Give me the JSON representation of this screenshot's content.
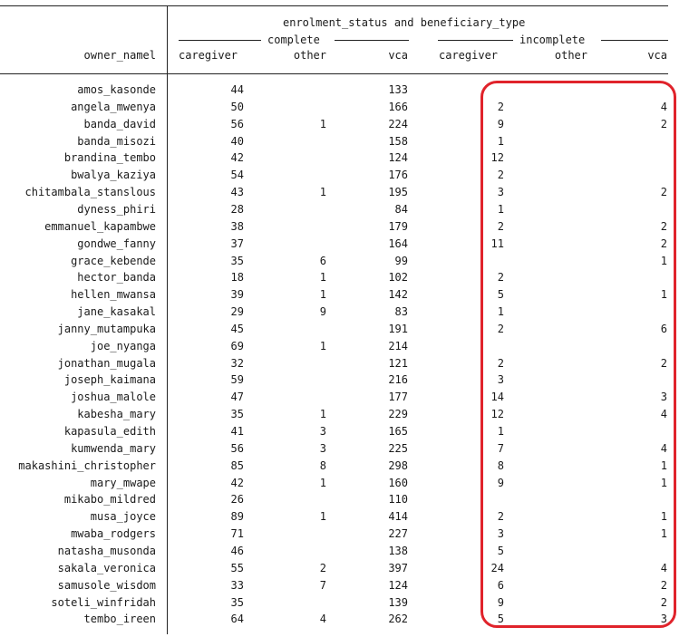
{
  "table": {
    "super_header": "enrolment_status and beneficiary_type",
    "group_complete": "complete",
    "group_incomplete": "incomplete",
    "row_header": "owner_namel",
    "columns": [
      "caregiver",
      "other",
      "vca",
      "caregiver",
      "other",
      "vca"
    ],
    "highlight_color": "#e0232b",
    "rows": [
      {
        "name": "amos_kasonde",
        "cc": "44",
        "co": "",
        "cv": "133",
        "ic": "",
        "io": "",
        "iv": ""
      },
      {
        "name": "angela_mwenya",
        "cc": "50",
        "co": "",
        "cv": "166",
        "ic": "2",
        "io": "",
        "iv": "4"
      },
      {
        "name": "banda_david",
        "cc": "56",
        "co": "1",
        "cv": "224",
        "ic": "9",
        "io": "",
        "iv": "2"
      },
      {
        "name": "banda_misozi",
        "cc": "40",
        "co": "",
        "cv": "158",
        "ic": "1",
        "io": "",
        "iv": ""
      },
      {
        "name": "brandina_tembo",
        "cc": "42",
        "co": "",
        "cv": "124",
        "ic": "12",
        "io": "",
        "iv": ""
      },
      {
        "name": "bwalya_kaziya",
        "cc": "54",
        "co": "",
        "cv": "176",
        "ic": "2",
        "io": "",
        "iv": ""
      },
      {
        "name": "chitambala_stanslous",
        "cc": "43",
        "co": "1",
        "cv": "195",
        "ic": "3",
        "io": "",
        "iv": "2"
      },
      {
        "name": "dyness_phiri",
        "cc": "28",
        "co": "",
        "cv": "84",
        "ic": "1",
        "io": "",
        "iv": ""
      },
      {
        "name": "emmanuel_kapambwe",
        "cc": "38",
        "co": "",
        "cv": "179",
        "ic": "2",
        "io": "",
        "iv": "2"
      },
      {
        "name": "gondwe_fanny",
        "cc": "37",
        "co": "",
        "cv": "164",
        "ic": "11",
        "io": "",
        "iv": "2"
      },
      {
        "name": "grace_kebende",
        "cc": "35",
        "co": "6",
        "cv": "99",
        "ic": "",
        "io": "",
        "iv": "1"
      },
      {
        "name": "hector_banda",
        "cc": "18",
        "co": "1",
        "cv": "102",
        "ic": "2",
        "io": "",
        "iv": ""
      },
      {
        "name": "hellen_mwansa",
        "cc": "39",
        "co": "1",
        "cv": "142",
        "ic": "5",
        "io": "",
        "iv": "1"
      },
      {
        "name": "jane_kasakal",
        "cc": "29",
        "co": "9",
        "cv": "83",
        "ic": "1",
        "io": "",
        "iv": ""
      },
      {
        "name": "janny_mutampuka",
        "cc": "45",
        "co": "",
        "cv": "191",
        "ic": "2",
        "io": "",
        "iv": "6"
      },
      {
        "name": "joe_nyanga",
        "cc": "69",
        "co": "1",
        "cv": "214",
        "ic": "",
        "io": "",
        "iv": ""
      },
      {
        "name": "jonathan_mugala",
        "cc": "32",
        "co": "",
        "cv": "121",
        "ic": "2",
        "io": "",
        "iv": "2"
      },
      {
        "name": "joseph_kaimana",
        "cc": "59",
        "co": "",
        "cv": "216",
        "ic": "3",
        "io": "",
        "iv": ""
      },
      {
        "name": "joshua_malole",
        "cc": "47",
        "co": "",
        "cv": "177",
        "ic": "14",
        "io": "",
        "iv": "3"
      },
      {
        "name": "kabesha_mary",
        "cc": "35",
        "co": "1",
        "cv": "229",
        "ic": "12",
        "io": "",
        "iv": "4"
      },
      {
        "name": "kapasula_edith",
        "cc": "41",
        "co": "3",
        "cv": "165",
        "ic": "1",
        "io": "",
        "iv": ""
      },
      {
        "name": "kumwenda_mary",
        "cc": "56",
        "co": "3",
        "cv": "225",
        "ic": "7",
        "io": "",
        "iv": "4"
      },
      {
        "name": "makashini_christopher",
        "cc": "85",
        "co": "8",
        "cv": "298",
        "ic": "8",
        "io": "",
        "iv": "1"
      },
      {
        "name": "mary_mwape",
        "cc": "42",
        "co": "1",
        "cv": "160",
        "ic": "9",
        "io": "",
        "iv": "1"
      },
      {
        "name": "mikabo_mildred",
        "cc": "26",
        "co": "",
        "cv": "110",
        "ic": "",
        "io": "",
        "iv": ""
      },
      {
        "name": "musa_joyce",
        "cc": "89",
        "co": "1",
        "cv": "414",
        "ic": "2",
        "io": "",
        "iv": "1"
      },
      {
        "name": "mwaba_rodgers",
        "cc": "71",
        "co": "",
        "cv": "227",
        "ic": "3",
        "io": "",
        "iv": "1"
      },
      {
        "name": "natasha_musonda",
        "cc": "46",
        "co": "",
        "cv": "138",
        "ic": "5",
        "io": "",
        "iv": ""
      },
      {
        "name": "sakala_veronica",
        "cc": "55",
        "co": "2",
        "cv": "397",
        "ic": "24",
        "io": "",
        "iv": "4"
      },
      {
        "name": "samusole_wisdom",
        "cc": "33",
        "co": "7",
        "cv": "124",
        "ic": "6",
        "io": "",
        "iv": "2"
      },
      {
        "name": "soteli_winfridah",
        "cc": "35",
        "co": "",
        "cv": "139",
        "ic": "9",
        "io": "",
        "iv": "2"
      },
      {
        "name": "tembo_ireen",
        "cc": "64",
        "co": "4",
        "cv": "262",
        "ic": "5",
        "io": "",
        "iv": "3"
      }
    ]
  }
}
